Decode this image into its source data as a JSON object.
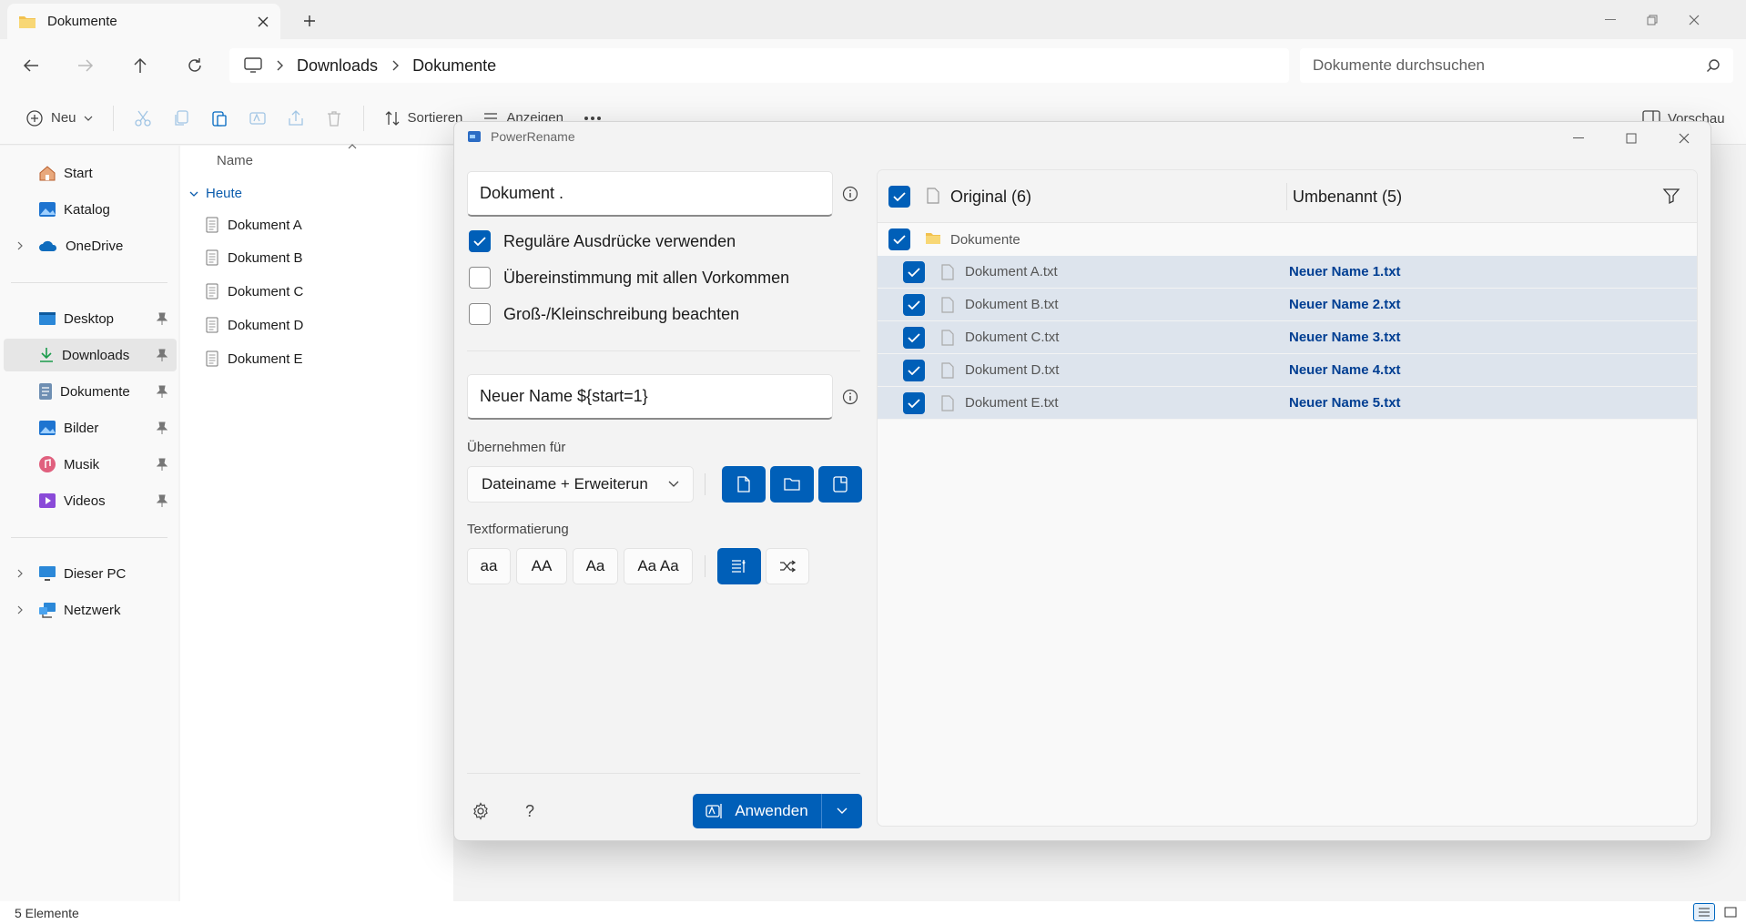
{
  "explorer": {
    "tab_title": "Dokumente",
    "breadcrumb": [
      "Downloads",
      "Dokumente"
    ],
    "search_placeholder": "Dokumente durchsuchen",
    "toolbar": {
      "new_label": "Neu",
      "sort_label": "Sortieren",
      "view_label": "Anzeigen",
      "preview_label": "Vorschau"
    },
    "sidebar": {
      "top": [
        {
          "label": "Start",
          "icon": "home-icon"
        },
        {
          "label": "Katalog",
          "icon": "gallery-icon"
        },
        {
          "label": "OneDrive",
          "icon": "cloud-icon"
        }
      ],
      "pinned": [
        {
          "label": "Desktop",
          "icon": "desktop-icon"
        },
        {
          "label": "Downloads",
          "icon": "download-icon"
        },
        {
          "label": "Dokumente",
          "icon": "document-icon"
        },
        {
          "label": "Bilder",
          "icon": "pictures-icon"
        },
        {
          "label": "Musik",
          "icon": "music-icon"
        },
        {
          "label": "Videos",
          "icon": "video-icon"
        }
      ],
      "bottom": [
        {
          "label": "Dieser PC",
          "icon": "pc-icon"
        },
        {
          "label": "Netzwerk",
          "icon": "network-icon"
        }
      ]
    },
    "column_name": "Name",
    "group_label": "Heute",
    "files": [
      "Dokument A",
      "Dokument B",
      "Dokument C",
      "Dokument D",
      "Dokument E"
    ],
    "status_text": "5 Elemente"
  },
  "powerrename": {
    "title": "PowerRename",
    "search_value": "Dokument .",
    "options": [
      {
        "label": "Reguläre Ausdrücke verwenden",
        "checked": true
      },
      {
        "label": "Übereinstimmung mit allen Vorkommen",
        "checked": false
      },
      {
        "label": "Groß-/Kleinschreibung beachten",
        "checked": false
      }
    ],
    "replace_value": "Neuer Name ${start=1}",
    "apply_for_label": "Übernehmen für",
    "apply_for_value": "Dateiname + Erweiterun",
    "text_format_label": "Textformatierung",
    "format_buttons": [
      "aa",
      "AA",
      "Aa",
      "Aa Aa"
    ],
    "apply_button": "Anwenden",
    "header_original": "Original (6)",
    "header_renamed": "Umbenannt (5)",
    "folder_name": "Dokumente",
    "items": [
      {
        "original": "Dokument A.txt",
        "renamed": "Neuer Name 1.txt"
      },
      {
        "original": "Dokument B.txt",
        "renamed": "Neuer Name 2.txt"
      },
      {
        "original": "Dokument C.txt",
        "renamed": "Neuer Name 3.txt"
      },
      {
        "original": "Dokument D.txt",
        "renamed": "Neuer Name 4.txt"
      },
      {
        "original": "Dokument E.txt",
        "renamed": "Neuer Name 5.txt"
      }
    ],
    "accent_color": "#005fb8"
  }
}
